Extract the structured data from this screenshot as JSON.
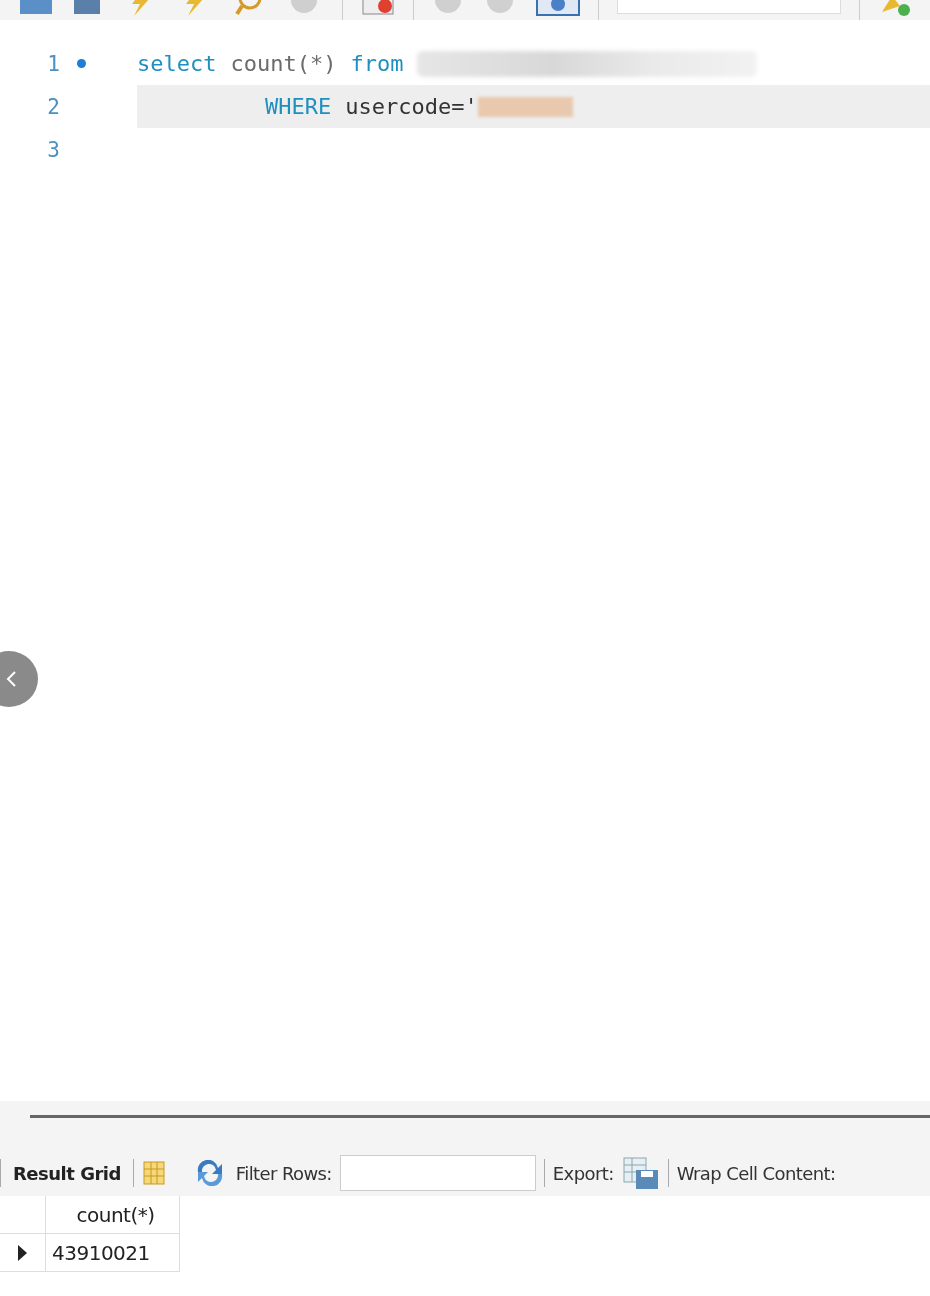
{
  "toolbar": {
    "toggle_on": true
  },
  "editor": {
    "lines": [
      {
        "number": "1",
        "marker": true,
        "current": false,
        "indented": false,
        "tokens": [
          {
            "kind": "keyword",
            "text": "select"
          },
          {
            "kind": "function",
            "text": "count(*)"
          },
          {
            "kind": "keyword",
            "text": "from"
          },
          {
            "kind": "blurred"
          }
        ]
      },
      {
        "number": "2",
        "marker": false,
        "current": true,
        "indented": true,
        "tokens": [
          {
            "kind": "keyword",
            "text": "WHERE"
          },
          {
            "kind": "plain",
            "text": "usercode='"
          },
          {
            "kind": "masked"
          }
        ]
      },
      {
        "number": "3",
        "marker": false,
        "current": false
      }
    ]
  },
  "results": {
    "tab": {
      "label": "Result Grid",
      "selected": true
    },
    "filter_label": "Filter Rows:",
    "export_label": "Export:",
    "wrap_label": "Wrap Cell Content:",
    "columns": [
      "count(*)"
    ],
    "rows": [
      {
        "cells": [
          "43910021"
        ],
        "current": true
      }
    ]
  }
}
